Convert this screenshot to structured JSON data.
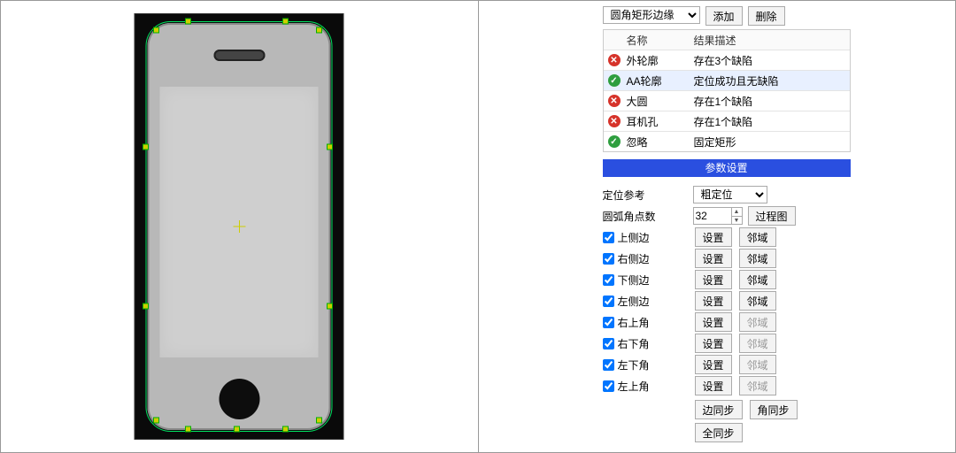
{
  "toprow": {
    "roi_type_label": "圆角矩形边缘",
    "add_label": "添加",
    "delete_label": "删除"
  },
  "table": {
    "col_name": "名称",
    "col_desc": "结果描述",
    "rows": [
      {
        "status": "err",
        "name": "外轮廓",
        "desc": "存在3个缺陷",
        "selected": false
      },
      {
        "status": "ok",
        "name": "AA轮廓",
        "desc": "定位成功且无缺陷",
        "selected": true
      },
      {
        "status": "err",
        "name": "大圆",
        "desc": "存在1个缺陷",
        "selected": false
      },
      {
        "status": "err",
        "name": "耳机孔",
        "desc": "存在1个缺陷",
        "selected": false
      },
      {
        "status": "ok",
        "name": "忽略",
        "desc": "固定矩形",
        "selected": false
      }
    ]
  },
  "section_header": "参数设置",
  "params": {
    "loc_ref_label": "定位参考",
    "loc_ref_value": "粗定位",
    "arc_pts_label": "圆弧角点数",
    "arc_pts_value": "32",
    "proc_img_label": "过程图",
    "set_btn": "设置",
    "neigh_btn": "邻域",
    "sides": [
      {
        "key": "top",
        "label": "上侧边",
        "checked": true,
        "neigh_enabled": true
      },
      {
        "key": "right",
        "label": "右侧边",
        "checked": true,
        "neigh_enabled": true
      },
      {
        "key": "bottom",
        "label": "下侧边",
        "checked": true,
        "neigh_enabled": true
      },
      {
        "key": "left",
        "label": "左侧边",
        "checked": true,
        "neigh_enabled": true
      },
      {
        "key": "tr",
        "label": "右上角",
        "checked": true,
        "neigh_enabled": false
      },
      {
        "key": "br",
        "label": "右下角",
        "checked": true,
        "neigh_enabled": false
      },
      {
        "key": "bl",
        "label": "左下角",
        "checked": true,
        "neigh_enabled": false
      },
      {
        "key": "tl",
        "label": "左上角",
        "checked": true,
        "neigh_enabled": false
      }
    ],
    "edge_sync": "边同步",
    "corner_sync": "角同步",
    "all_sync": "全同步"
  }
}
